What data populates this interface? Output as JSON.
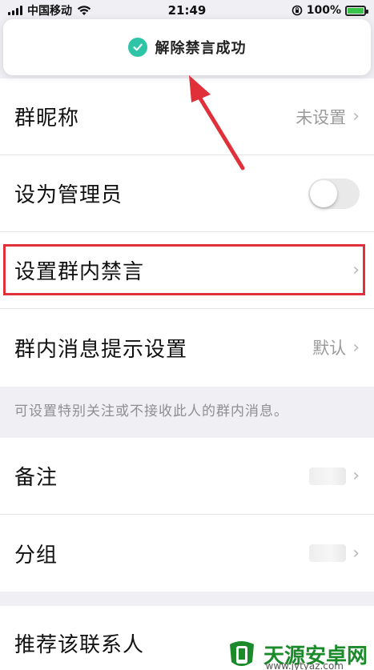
{
  "status_bar": {
    "carrier": "中国移动",
    "time": "21:49",
    "battery_percent": "100%"
  },
  "toast": {
    "message": "解除禁言成功"
  },
  "settings": {
    "nickname": {
      "label": "群昵称",
      "value": "未设置"
    },
    "admin": {
      "label": "设为管理员",
      "on": false
    },
    "mute": {
      "label": "设置群内禁言"
    },
    "notify": {
      "label": "群内消息提示设置",
      "value": "默认"
    },
    "hint": "可设置特别关注或不接收此人的群内消息。",
    "remark": {
      "label": "备注"
    },
    "group": {
      "label": "分组"
    },
    "recommend": {
      "label": "推荐该联系人"
    }
  },
  "watermark": {
    "title": "天源安卓网",
    "url": "www.jytyaz.com"
  },
  "colors": {
    "accent_toast_check": "#2ec4a8",
    "highlight_border": "#e0303a",
    "arrow": "#e0303a",
    "battery": "#38c34a"
  }
}
